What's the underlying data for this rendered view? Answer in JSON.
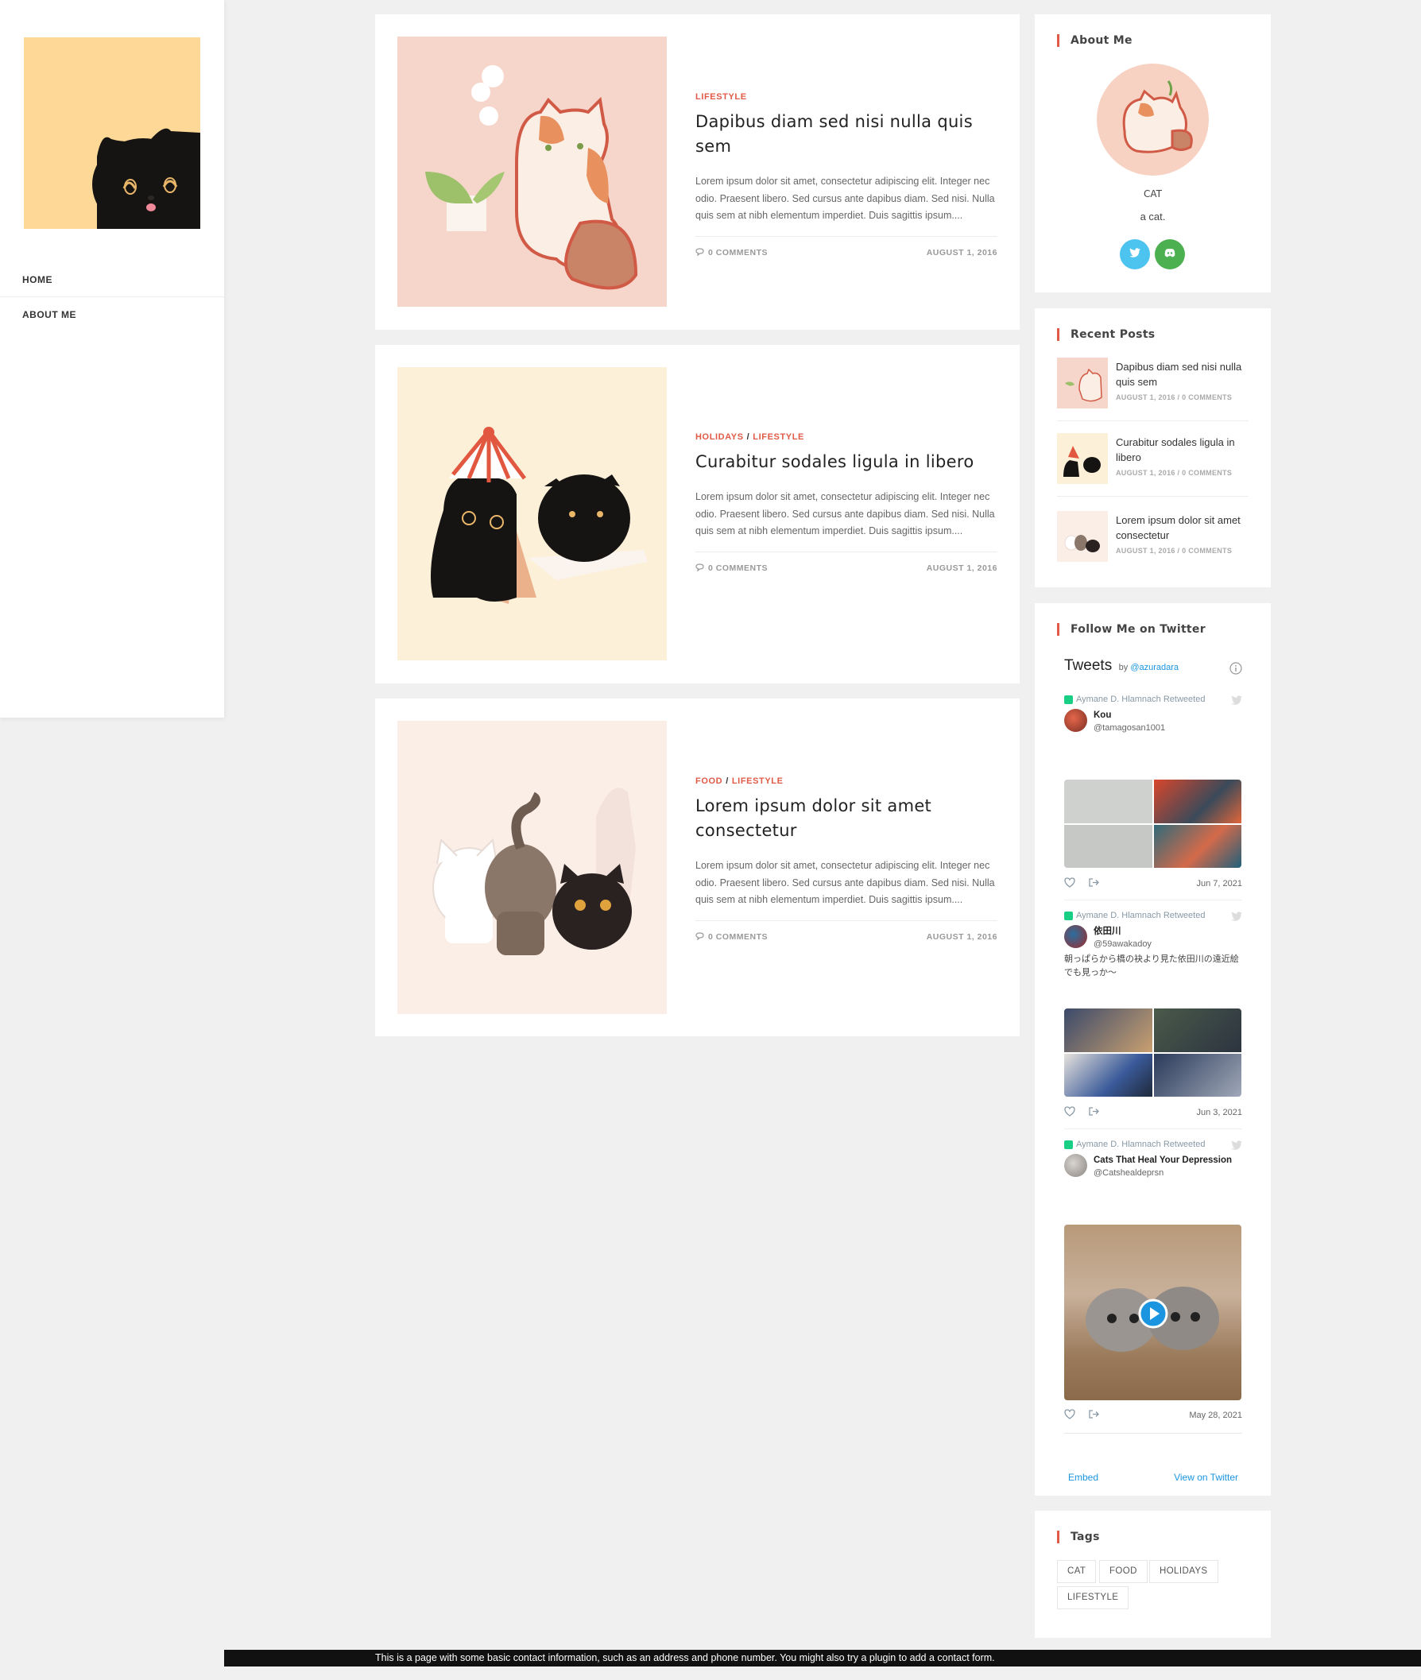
{
  "sidebar": {
    "nav": [
      {
        "label": "HOME"
      },
      {
        "label": "ABOUT ME"
      }
    ]
  },
  "posts": [
    {
      "categories": [
        "LIFESTYLE"
      ],
      "title": "Dapibus diam sed nisi nulla quis sem",
      "excerpt": "Lorem ipsum dolor sit amet, consectetur adipiscing elit. Integer nec odio. Praesent libero. Sed cursus ante dapibus diam. Sed nisi. Nulla quis sem at nibh elementum imperdiet. Duis sagittis ipsum....",
      "comments": "0 COMMENTS",
      "date": "AUGUST 1, 2016"
    },
    {
      "categories": [
        "HOLIDAYS",
        "LIFESTYLE"
      ],
      "title": "Curabitur sodales ligula in libero",
      "excerpt": "Lorem ipsum dolor sit amet, consectetur adipiscing elit. Integer nec odio. Praesent libero. Sed cursus ante dapibus diam. Sed nisi. Nulla quis sem at nibh elementum imperdiet. Duis sagittis ipsum....",
      "comments": "0 COMMENTS",
      "date": "AUGUST 1, 2016"
    },
    {
      "categories": [
        "FOOD",
        "LIFESTYLE"
      ],
      "title": "Lorem ipsum dolor sit amet consectetur",
      "excerpt": "Lorem ipsum dolor sit amet, consectetur adipiscing elit. Integer nec odio. Praesent libero. Sed cursus ante dapibus diam. Sed nisi. Nulla quis sem at nibh elementum imperdiet. Duis sagittis ipsum....",
      "comments": "0 COMMENTS",
      "date": "AUGUST 1, 2016"
    }
  ],
  "about": {
    "title": "About Me",
    "name": "CAT",
    "description": "a cat.",
    "social": [
      {
        "icon": "twitter-icon",
        "color": "#4dc3f0"
      },
      {
        "icon": "discord-icon",
        "color": "#4caf50"
      }
    ]
  },
  "recent": {
    "title": "Recent Posts",
    "items": [
      {
        "title": "Dapibus diam sed nisi nulla quis sem",
        "date": "AUGUST 1, 2016",
        "comments": "0 COMMENTS"
      },
      {
        "title": "Curabitur sodales ligula in libero",
        "date": "AUGUST 1, 2016",
        "comments": "0 COMMENTS"
      },
      {
        "title": "Lorem ipsum dolor sit amet consectetur",
        "date": "AUGUST 1, 2016",
        "comments": "0 COMMENTS"
      }
    ]
  },
  "twitter": {
    "title": "Follow Me on Twitter",
    "heading": "Tweets",
    "by": "by",
    "handle": "@azuradara",
    "tweets": [
      {
        "retweeted": "Aymane D. Hlamnach Retweeted",
        "name": "Kou",
        "handle": "@tamagosan1001",
        "text": "",
        "date": "Jun 7, 2021"
      },
      {
        "retweeted": "Aymane D. Hlamnach Retweeted",
        "name": "依田川",
        "handle": "@59awakadoy",
        "text": "朝っぱらから橋の袂より見た依田川の遠近絵でも見っか〜",
        "date": "Jun 3, 2021"
      },
      {
        "retweeted": "Aymane D. Hlamnach Retweeted",
        "name": "Cats That Heal Your Depression",
        "handle": "@Catshealdeprsn",
        "text": "",
        "date": "May 28, 2021"
      }
    ],
    "embed": "Embed",
    "view": "View on Twitter"
  },
  "tags": {
    "title": "Tags",
    "items": [
      "CAT",
      "FOOD",
      "HOLIDAYS",
      "LIFESTYLE"
    ]
  },
  "footer": {
    "text": "This is a page with some basic contact information, such as an address and phone number. You might also try a plugin to add a contact form."
  },
  "colors": {
    "accent": "#e05a47",
    "twitter_blue": "#1b95e0",
    "logo_bg": "#fdd896"
  }
}
